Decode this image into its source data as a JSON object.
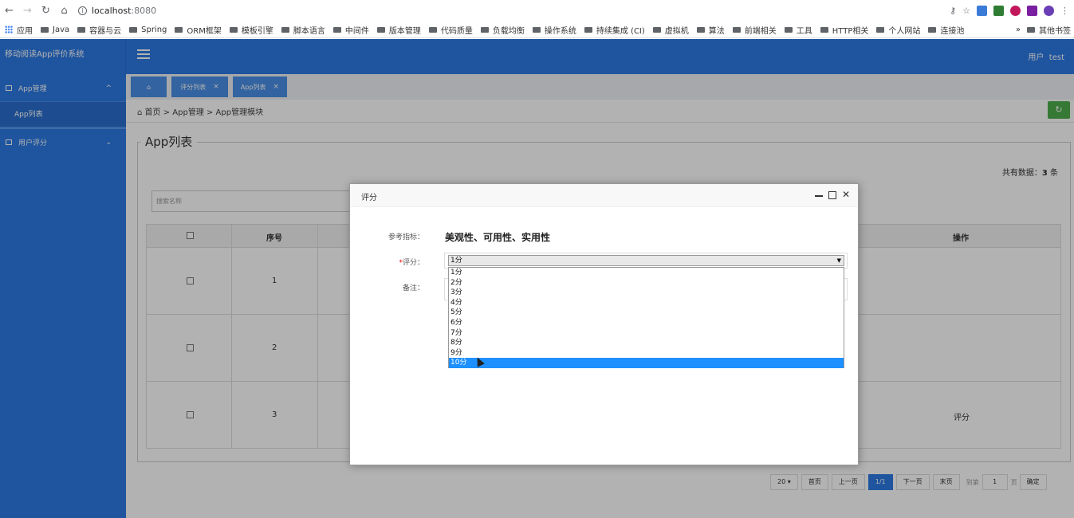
{
  "browser": {
    "url_host": "localhost",
    "url_port": ":8080",
    "bookmarks": [
      "应用",
      "Java",
      "容器与云",
      "Spring",
      "ORM框架",
      "模板引擎",
      "脚本语言",
      "中间件",
      "版本管理",
      "代码质量",
      "负载均衡",
      "操作系统",
      "持续集成 (CI)",
      "虚拟机",
      "算法",
      "前端相关",
      "工具",
      "HTTP相关",
      "个人网站",
      "连接池"
    ],
    "more": "»",
    "other_bookmarks": "其他书签"
  },
  "header": {
    "brand": "移动阅读App评价系统",
    "user_label": "用户",
    "user_name": "test"
  },
  "sidebar": {
    "groups": [
      {
        "label": "App管理",
        "chevron": "^"
      },
      {
        "label": "用户评分",
        "chevron": "⌄"
      }
    ],
    "sub_item": "App列表"
  },
  "tabs": [
    {
      "label": "⌂"
    },
    {
      "label": "评分列表",
      "close": "×"
    },
    {
      "label": "App列表",
      "close": "×"
    }
  ],
  "content": {
    "breadcrumb": "首页 > App管理 > App管理模块",
    "legend": "App列表",
    "count_label": "共有数据：",
    "count_value": "3",
    "count_unit": "条",
    "search_placeholder": "搜索名称",
    "columns": {
      "index": "序号",
      "action": "操作"
    },
    "rows": [
      {
        "index": "1",
        "action": ""
      },
      {
        "index": "2",
        "action": ""
      },
      {
        "index": "3",
        "action": "评分"
      }
    ],
    "pager": {
      "page_size": "20 ▾",
      "first": "首页",
      "prev": "上一页",
      "current": "1/1",
      "next": "下一页",
      "last": "末页",
      "goto_label": "到第",
      "goto_value": "1",
      "page_unit": "页",
      "confirm": "确定"
    }
  },
  "modal": {
    "title": "评分",
    "ref_label": "参考指标：",
    "ref_value": "美观性、可用性、实用性",
    "score_required": "*",
    "score_label": "评分：",
    "remark_label": "备注：",
    "selected_value": "1分",
    "options": [
      "1分",
      "2分",
      "3分",
      "4分",
      "5分",
      "6分",
      "7分",
      "8分",
      "9分",
      "10分"
    ],
    "highlighted_option": "10分"
  }
}
